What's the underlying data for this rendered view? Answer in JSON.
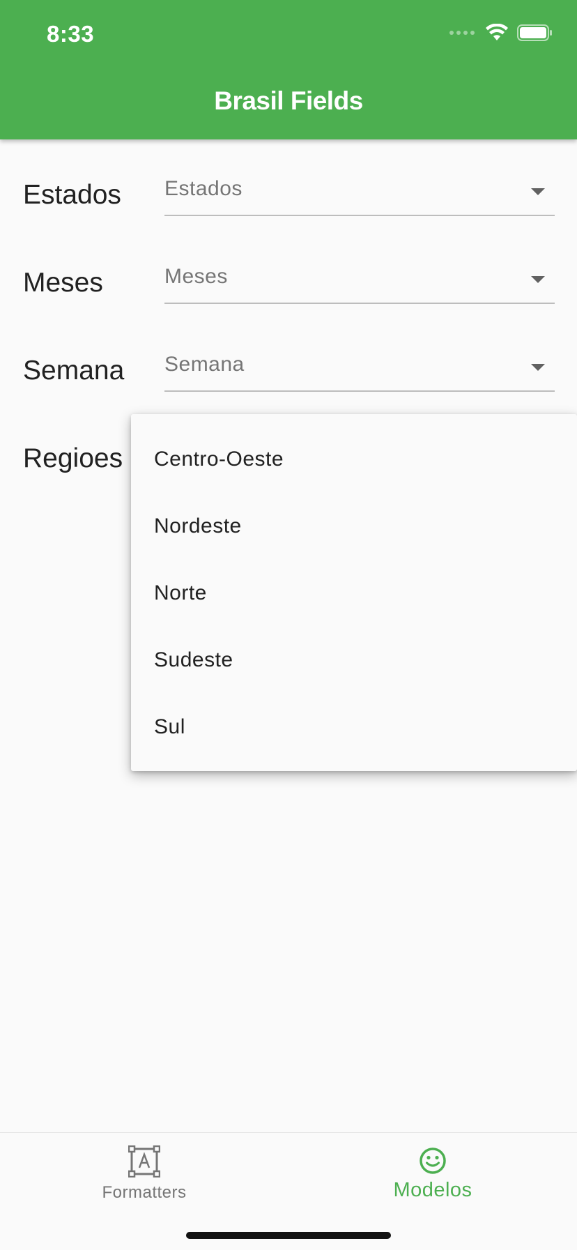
{
  "status_bar": {
    "time": "8:33"
  },
  "app_bar": {
    "title": "Brasil Fields"
  },
  "form": {
    "rows": [
      {
        "label": "Estados",
        "hint": "Estados"
      },
      {
        "label": "Meses",
        "hint": "Meses"
      },
      {
        "label": "Semana",
        "hint": "Semana"
      },
      {
        "label": "Regioes"
      }
    ]
  },
  "menu": {
    "items": [
      "Centro-Oeste",
      "Nordeste",
      "Norte",
      "Sudeste",
      "Sul"
    ]
  },
  "bottom_nav": {
    "items": [
      {
        "label": "Formatters",
        "icon": "text-frame-icon",
        "active": false
      },
      {
        "label": "Modelos",
        "icon": "smiley-icon",
        "active": true
      }
    ]
  },
  "colors": {
    "primary": "#4caf50",
    "background": "#fafafa",
    "inactive": "#757575"
  }
}
